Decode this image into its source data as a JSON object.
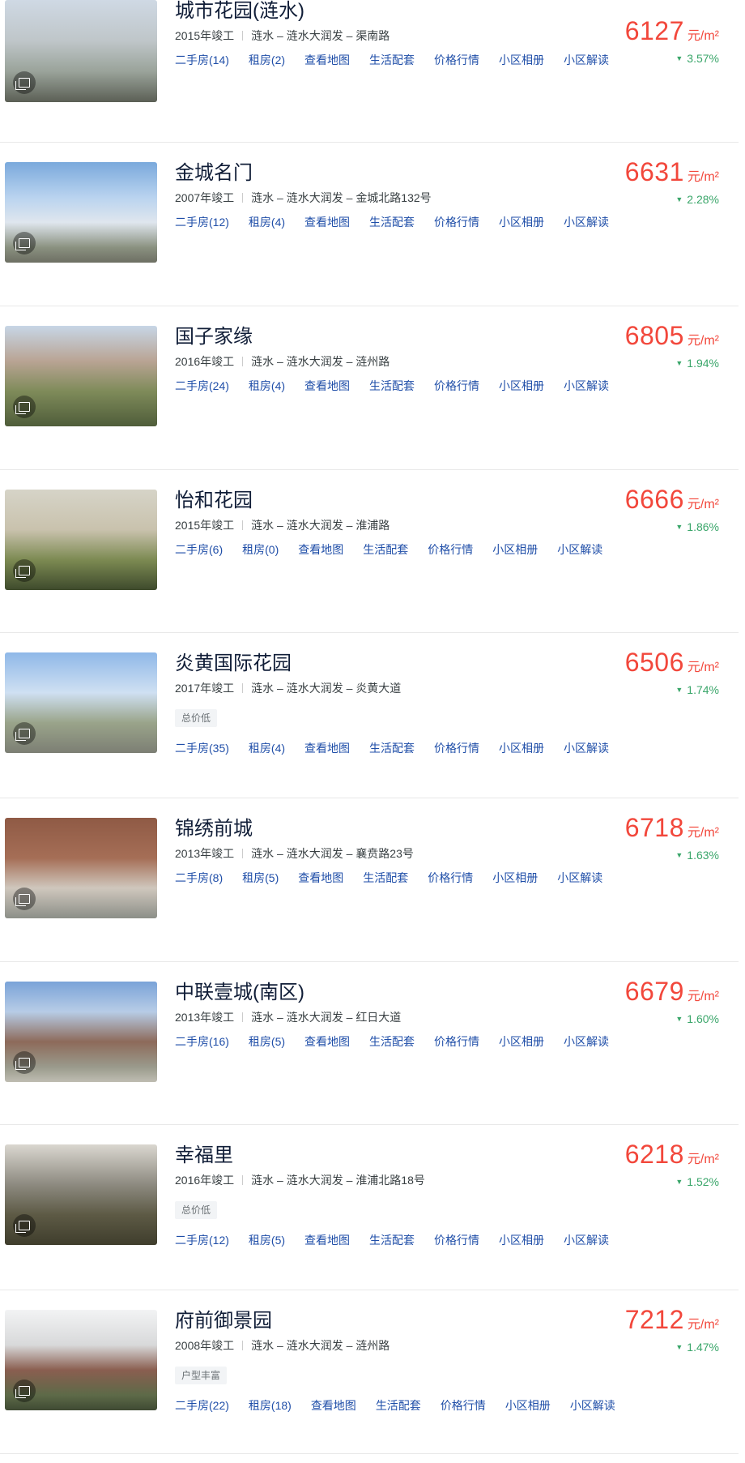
{
  "colors": {
    "price": "#f2473b",
    "change_down": "#3aa66a",
    "link": "#1f4ea8",
    "title": "#101d37"
  },
  "listings": [
    {
      "name": "城市花园(涟水)",
      "year": "2015年竣工",
      "district": "涟水",
      "area": "涟水大润发",
      "road": "渠南路",
      "tag": "",
      "links": [
        "二手房(14)",
        "租房(2)",
        "查看地图",
        "生活配套",
        "价格行情",
        "小区相册",
        "小区解读"
      ],
      "price": "6127",
      "unit": "元/m²",
      "change_icon": "down-triangle-icon",
      "change": "3.57%"
    },
    {
      "name": "金城名门",
      "year": "2007年竣工",
      "district": "涟水",
      "area": "涟水大润发",
      "road": "金城北路132号",
      "tag": "",
      "links": [
        "二手房(12)",
        "租房(4)",
        "查看地图",
        "生活配套",
        "价格行情",
        "小区相册",
        "小区解读"
      ],
      "price": "6631",
      "unit": "元/m²",
      "change_icon": "down-triangle-icon",
      "change": "2.28%"
    },
    {
      "name": "国子家缘",
      "year": "2016年竣工",
      "district": "涟水",
      "area": "涟水大润发",
      "road": "涟州路",
      "tag": "",
      "links": [
        "二手房(24)",
        "租房(4)",
        "查看地图",
        "生活配套",
        "价格行情",
        "小区相册",
        "小区解读"
      ],
      "price": "6805",
      "unit": "元/m²",
      "change_icon": "down-triangle-icon",
      "change": "1.94%"
    },
    {
      "name": "怡和花园",
      "year": "2015年竣工",
      "district": "涟水",
      "area": "涟水大润发",
      "road": "淮浦路",
      "tag": "",
      "links": [
        "二手房(6)",
        "租房(0)",
        "查看地图",
        "生活配套",
        "价格行情",
        "小区相册",
        "小区解读"
      ],
      "price": "6666",
      "unit": "元/m²",
      "change_icon": "down-triangle-icon",
      "change": "1.86%"
    },
    {
      "name": "炎黄国际花园",
      "year": "2017年竣工",
      "district": "涟水",
      "area": "涟水大润发",
      "road": "炎黄大道",
      "tag": "总价低",
      "links": [
        "二手房(35)",
        "租房(4)",
        "查看地图",
        "生活配套",
        "价格行情",
        "小区相册",
        "小区解读"
      ],
      "price": "6506",
      "unit": "元/m²",
      "change_icon": "down-triangle-icon",
      "change": "1.74%"
    },
    {
      "name": "锦绣前城",
      "year": "2013年竣工",
      "district": "涟水",
      "area": "涟水大润发",
      "road": "襄贲路23号",
      "tag": "",
      "links": [
        "二手房(8)",
        "租房(5)",
        "查看地图",
        "生活配套",
        "价格行情",
        "小区相册",
        "小区解读"
      ],
      "price": "6718",
      "unit": "元/m²",
      "change_icon": "down-triangle-icon",
      "change": "1.63%"
    },
    {
      "name": "中联壹城(南区)",
      "year": "2013年竣工",
      "district": "涟水",
      "area": "涟水大润发",
      "road": "红日大道",
      "tag": "",
      "links": [
        "二手房(16)",
        "租房(5)",
        "查看地图",
        "生活配套",
        "价格行情",
        "小区相册",
        "小区解读"
      ],
      "price": "6679",
      "unit": "元/m²",
      "change_icon": "down-triangle-icon",
      "change": "1.60%"
    },
    {
      "name": "幸福里",
      "year": "2016年竣工",
      "district": "涟水",
      "area": "涟水大润发",
      "road": "淮浦北路18号",
      "tag": "总价低",
      "links": [
        "二手房(12)",
        "租房(5)",
        "查看地图",
        "生活配套",
        "价格行情",
        "小区相册",
        "小区解读"
      ],
      "price": "6218",
      "unit": "元/m²",
      "change_icon": "down-triangle-icon",
      "change": "1.52%"
    },
    {
      "name": "府前御景园",
      "year": "2008年竣工",
      "district": "涟水",
      "area": "涟水大润发",
      "road": "涟州路",
      "tag": "户型丰富",
      "links": [
        "二手房(22)",
        "租房(18)",
        "查看地图",
        "生活配套",
        "价格行情",
        "小区相册",
        "小区解读"
      ],
      "price": "7212",
      "unit": "元/m²",
      "change_icon": "down-triangle-icon",
      "change": "1.47%"
    }
  ]
}
